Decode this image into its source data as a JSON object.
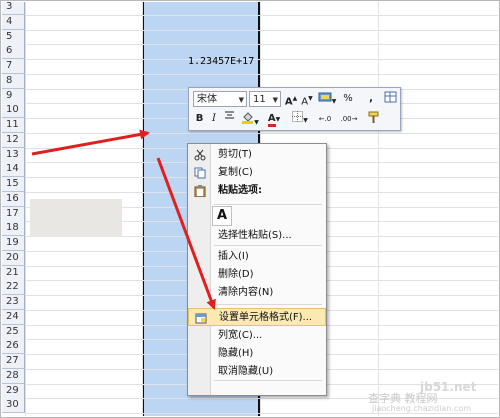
{
  "sheet": {
    "rows": [
      "3",
      "4",
      "5",
      "6",
      "7",
      "8",
      "9",
      "10",
      "11",
      "12",
      "13",
      "14",
      "15",
      "16",
      "17",
      "18",
      "19",
      "20",
      "21",
      "22",
      "23",
      "24",
      "25",
      "26",
      "27",
      "28",
      "29",
      "30"
    ],
    "cell_value": "1.23457E+17"
  },
  "mini_toolbar": {
    "font_name": "宋体",
    "font_size": "11",
    "percent": "%",
    "comma": ",",
    "bold": "B",
    "italic": "I"
  },
  "context_menu": {
    "items": [
      {
        "label": "剪切(T)",
        "icon": "scissors-icon"
      },
      {
        "label": "复制(C)",
        "icon": "copy-icon"
      },
      {
        "label": "粘贴选项:",
        "icon": "clipboard-icon"
      },
      {
        "label": "选择性粘贴(S)..."
      },
      {
        "label": "插入(I)"
      },
      {
        "label": "删除(D)"
      },
      {
        "label": "清除内容(N)"
      },
      {
        "label": "设置单元格格式(F)...",
        "icon": "format-cells-icon"
      },
      {
        "label": "列宽(C)..."
      },
      {
        "label": "隐藏(H)"
      },
      {
        "label": "取消隐藏(U)"
      }
    ],
    "paste_option": "A"
  },
  "watermark": {
    "site": "jb51.net",
    "text": "查字典 教程网",
    "url": "jiaocheng.chazidian.com"
  },
  "colors": {
    "selection": "#bcd5f2",
    "arrow": "#e02020",
    "highlight": "#fbe9b2"
  }
}
